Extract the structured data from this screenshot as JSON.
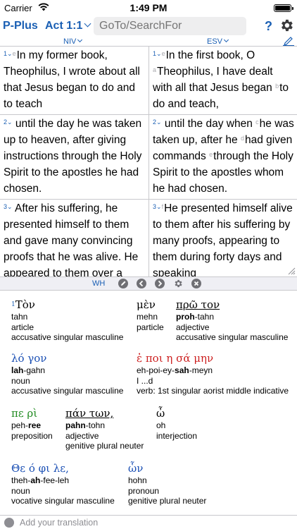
{
  "status": {
    "carrier": "Carrier",
    "time": "1:49 PM"
  },
  "nav": {
    "app_label": "P-Plus",
    "reference": "Act 1:1",
    "search_placeholder": "GoTo/SearchFor",
    "help_label": "?"
  },
  "versions": {
    "left": "NIV",
    "right": "ESV"
  },
  "verses": [
    {
      "left": {
        "num": "1",
        "text": "In my former book, Theophilus, I wrote about all that Jesus began to do and to teach"
      },
      "right": {
        "num": "1",
        "parts": [
          {
            "fn": "",
            "text": "In the first book, O "
          },
          {
            "fn": "a",
            "text": "Theophilus, I have dealt with all that Jesus began "
          },
          {
            "fn": "b",
            "text": "to do and teach,"
          }
        ]
      }
    },
    {
      "left": {
        "num": "2",
        "text": "until the day he was taken up to heaven, after giving instructions through the Holy Spirit to the apostles he had chosen."
      },
      "right": {
        "num": "2",
        "parts": [
          {
            "fn": "",
            "text": "until the day when "
          },
          {
            "fn": "c",
            "text": "he was taken up, after he "
          },
          {
            "fn": "d",
            "text": "had given commands "
          },
          {
            "fn": "e",
            "text": "through the Holy Spirit to the apostles whom he had chosen."
          }
        ]
      }
    },
    {
      "left": {
        "num": "3",
        "text": "After his suffering, he presented himself to them and gave many convincing proofs that he was alive. He appeared to them over a"
      },
      "right": {
        "num": "3",
        "parts": [
          {
            "fn": "f",
            "text": "He presented himself alive to them after his suffering by many proofs, appearing to them during forty days and speaking"
          }
        ]
      }
    }
  ],
  "toolbar": {
    "wh_label": "WH"
  },
  "interlinear": [
    {
      "num": "1",
      "greek": "Τὸν",
      "color": "#000000",
      "underline": false,
      "translit": [
        {
          "t": "tahn",
          "b": false
        }
      ],
      "gloss": "article",
      "morph": "accusative singular masculine"
    },
    {
      "num": "",
      "greek": "μὲν",
      "color": "#000000",
      "underline": false,
      "translit": [
        {
          "t": "mehn",
          "b": false
        }
      ],
      "gloss": "particle",
      "morph": ""
    },
    {
      "num": "",
      "greek": "πρῶ τον",
      "color": "#000000",
      "underline": true,
      "translit": [
        {
          "t": "proh",
          "b": true
        },
        {
          "t": "-tahn",
          "b": false
        }
      ],
      "gloss": "adjective",
      "morph": "accusative singular masculine"
    },
    {
      "num": "",
      "greek": "λό γον",
      "color": "#1a4fb4",
      "underline": false,
      "translit": [
        {
          "t": "lah",
          "b": true
        },
        {
          "t": "-gahn",
          "b": false
        }
      ],
      "gloss": "noun",
      "morph": "accusative singular masculine"
    },
    {
      "num": "",
      "greek": "ἐ ποι η σά μην",
      "color": "#cc1f1f",
      "underline": false,
      "translit": [
        {
          "t": "eh-poi-ey-",
          "b": false
        },
        {
          "t": "sah",
          "b": true
        },
        {
          "t": "-meyn",
          "b": false
        }
      ],
      "gloss": "I ...d",
      "morph": "verb: 1st singular aorist middle indicative"
    },
    {
      "num": "",
      "greek": "πε ρὶ",
      "color": "#1f8a1f",
      "underline": false,
      "translit": [
        {
          "t": "peh-",
          "b": false
        },
        {
          "t": "ree",
          "b": true
        }
      ],
      "gloss": "preposition",
      "morph": ""
    },
    {
      "num": "",
      "greek": "πάν των,",
      "color": "#000000",
      "underline": true,
      "translit": [
        {
          "t": "pahn",
          "b": true
        },
        {
          "t": "-tohn",
          "b": false
        }
      ],
      "gloss": "adjective",
      "morph": "genitive plural neuter"
    },
    {
      "num": "",
      "greek": "ὦ",
      "color": "#000000",
      "underline": false,
      "translit": [
        {
          "t": "oh",
          "b": false
        }
      ],
      "gloss": "interjection",
      "morph": ""
    },
    {
      "num": "",
      "greek": "Θε ό φι λε,",
      "color": "#1a4fb4",
      "underline": false,
      "translit": [
        {
          "t": "theh-",
          "b": false
        },
        {
          "t": "ah",
          "b": true
        },
        {
          "t": "-fee-leh",
          "b": false
        }
      ],
      "gloss": "noun",
      "morph": "vocative singular masculine"
    },
    {
      "num": "",
      "greek": "ὧν",
      "color": "#1a4fb4",
      "underline": false,
      "translit": [
        {
          "t": "hohn",
          "b": false
        }
      ],
      "gloss": "pronoun",
      "morph": "genitive plural neuter"
    }
  ],
  "bottom": {
    "placeholder": "Add your translation"
  },
  "colors": {
    "accent": "#1a5fb4",
    "divider": "#c8c8cc",
    "toolbar_bg": "#efeff4",
    "search_bg": "#eeeeef"
  }
}
